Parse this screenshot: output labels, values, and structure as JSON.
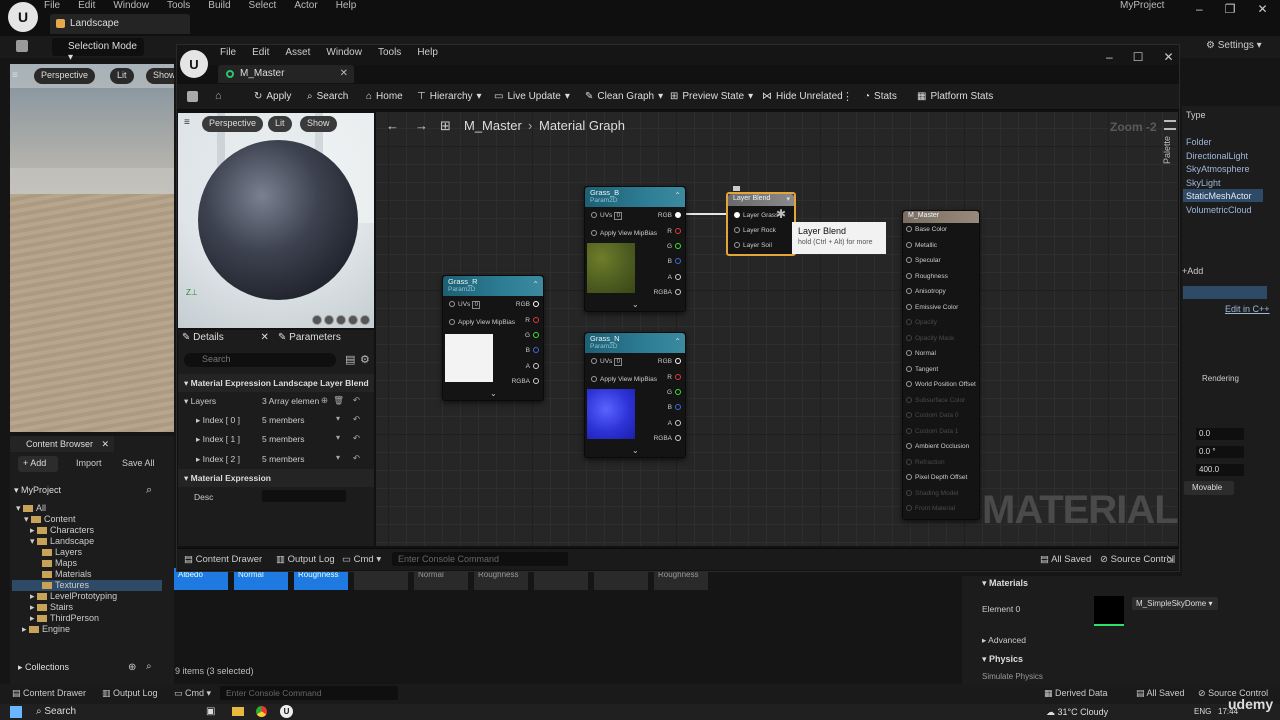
{
  "main_window": {
    "menu": [
      "File",
      "Edit",
      "Window",
      "Tools",
      "Build",
      "Select",
      "Actor",
      "Help"
    ],
    "project_name": "MyProject",
    "level_tab": "Landscape",
    "selection_mode": "Selection Mode",
    "settings_label": "Settings"
  },
  "viewport": {
    "perspective": "Perspective",
    "lit": "Lit",
    "show": "Show"
  },
  "content_browser": {
    "tab_label": "Content Browser",
    "add_label": "Add",
    "import_label": "Import",
    "save_all_label": "Save All",
    "project_label": "MyProject",
    "tree": [
      {
        "label": "All"
      },
      {
        "label": "Content"
      },
      {
        "label": "Characters"
      },
      {
        "label": "Landscape"
      },
      {
        "label": "Layers"
      },
      {
        "label": "Maps"
      },
      {
        "label": "Materials"
      },
      {
        "label": "Textures"
      },
      {
        "label": "LevelPrototyping"
      },
      {
        "label": "Stairs"
      },
      {
        "label": "ThirdPerson"
      },
      {
        "label": "Engine"
      }
    ],
    "collections_label": "Collections",
    "items_count": "9 items (3 selected)"
  },
  "bottom_bar": {
    "content_drawer": "Content Drawer",
    "output_log": "Output Log",
    "cmd": "Cmd",
    "console_placeholder": "Enter Console Command",
    "derived_data": "Derived Data",
    "all_saved": "All Saved",
    "source_control": "Source Control"
  },
  "right_panel": {
    "type_header": "Type",
    "outliner_types": [
      "Folder",
      "DirectionalLight",
      "SkyAtmosphere",
      "SkyLight",
      "StaticMeshActor",
      "VolumetricCloud"
    ],
    "add_label": "Add",
    "edit_cpp": "Edit in C++",
    "rendering": "Rendering",
    "fields": [
      "0.0",
      "0.0 °",
      "400.0"
    ],
    "movable": "Movable",
    "materials_header": "Materials",
    "element0": "Element 0",
    "material_name": "M_SimpleSkyDome",
    "advanced": "Advanced",
    "physics": "Physics",
    "simulate_physics": "Simulate Physics"
  },
  "thumb_strip": [
    "Albedo",
    "Normal",
    "Roughness",
    "",
    "Normal",
    "Roughness",
    "",
    "",
    "Roughness"
  ],
  "material_editor": {
    "menu": [
      "File",
      "Edit",
      "Asset",
      "Window",
      "Tools",
      "Help"
    ],
    "tab_title": "M_Master",
    "toolbar": {
      "apply": "Apply",
      "search": "Search",
      "home": "Home",
      "hierarchy": "Hierarchy",
      "live_update": "Live Update",
      "clean_graph": "Clean Graph",
      "preview_state": "Preview State",
      "hide_unrelated": "Hide Unrelated",
      "stats": "Stats",
      "platform_stats": "Platform Stats"
    },
    "preview": {
      "perspective": "Perspective",
      "lit": "Lit",
      "show": "Show"
    },
    "details": {
      "details_tab": "Details",
      "parameters_tab": "Parameters",
      "search_placeholder": "Search",
      "section_title": "Material Expression Landscape Layer Blend",
      "layers_label": "Layers",
      "layers_value": "3 Array elemen",
      "index0": "Index [ 0 ]",
      "index1": "Index [ 1 ]",
      "index2": "Index [ 2 ]",
      "members": "5 members",
      "section_expr": "Material Expression",
      "desc_label": "Desc"
    },
    "breadcrumb_root": "M_Master",
    "breadcrumb_sep": "›",
    "breadcrumb_graph": "Material Graph",
    "zoom": "Zoom -2",
    "palette": "Palette",
    "watermark": "MATERIAL",
    "nodes": {
      "grass_b": {
        "title": "Grass_B",
        "sub": "Param2D"
      },
      "grass_r": {
        "title": "Grass_R",
        "sub": "Param2D"
      },
      "grass_n": {
        "title": "Grass_N",
        "sub": "Param2D"
      },
      "uvs": "UVs",
      "uv_index": "0",
      "apply_mip": "Apply View MipBias",
      "outputs": [
        "RGB",
        "R",
        "G",
        "B",
        "A",
        "RGBA"
      ],
      "layer_blend": {
        "title": "Layer Blend",
        "pins": [
          "Layer Grass",
          "Layer Rock",
          "Layer Soil"
        ]
      },
      "master": {
        "title": "M_Master",
        "pins": [
          "Base Color",
          "Metallic",
          "Specular",
          "Roughness",
          "Anisotropy",
          "Emissive Color",
          "Opacity",
          "Opacity Mask",
          "Normal",
          "Tangent",
          "World Position Offset",
          "Subsurface Color",
          "Custom Data 0",
          "Custom Data 1",
          "Ambient Occlusion",
          "Refraction",
          "Pixel Depth Offset",
          "Shading Model",
          "Front Material"
        ]
      }
    },
    "tooltip": {
      "title": "Layer Blend",
      "hint": "hold (Ctrl + Alt) for more"
    },
    "bottom": {
      "content_drawer": "Content Drawer",
      "output_log": "Output Log",
      "cmd": "Cmd",
      "console_placeholder": "Enter Console Command",
      "all_saved": "All Saved",
      "source_control": "Source Control"
    }
  },
  "taskbar": {
    "search": "Search",
    "weather": "31°C  Cloudy",
    "lang": "ENG",
    "time": "17:44",
    "udemy": "udemy"
  }
}
